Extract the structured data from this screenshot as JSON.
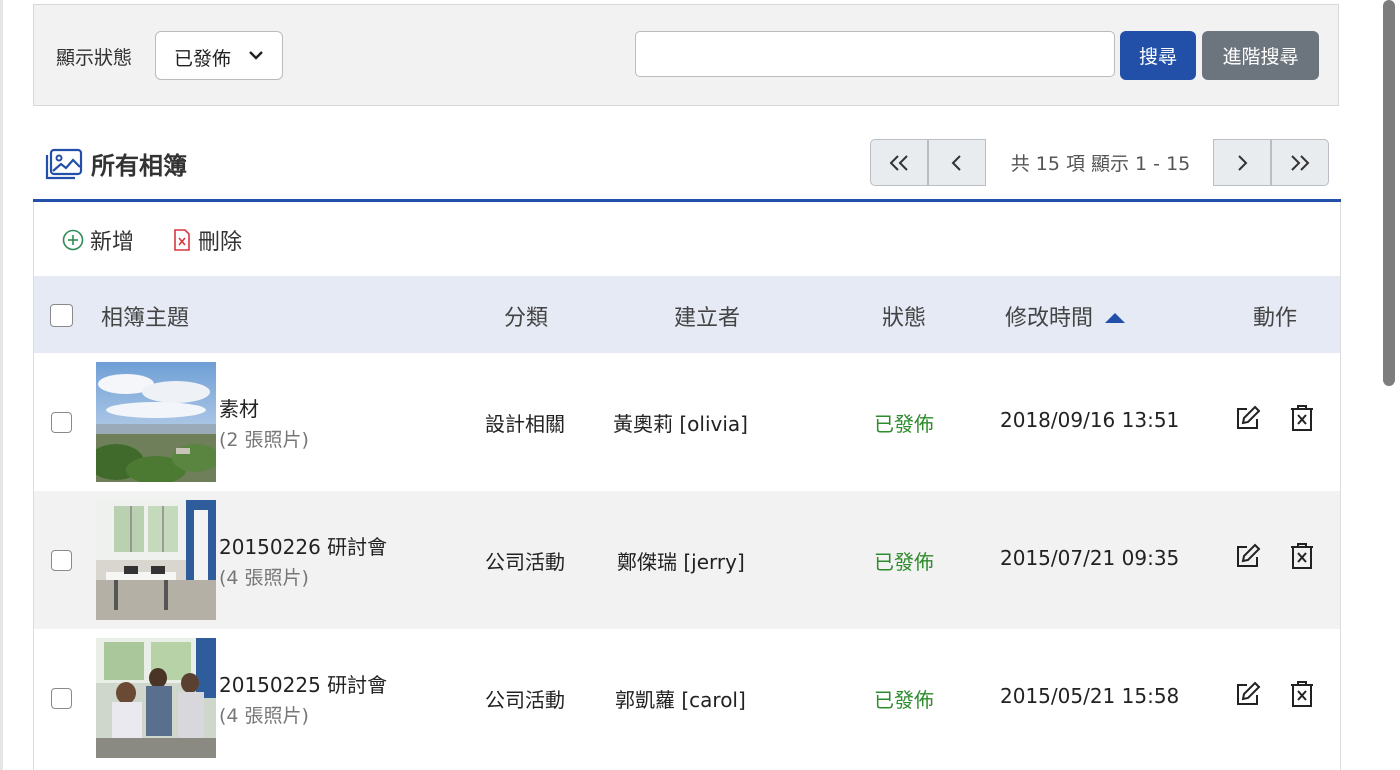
{
  "filter": {
    "status_label": "顯示狀態",
    "status_value": "已發佈",
    "search_value": "",
    "search_button": "搜尋",
    "advanced_button": "進階搜尋"
  },
  "section": {
    "title": "所有相簿"
  },
  "pager": {
    "info": "共 15 項 顯示 1 - 15"
  },
  "toolbar": {
    "add": "新增",
    "delete": "刪除"
  },
  "table": {
    "headers": {
      "subject": "相簿主題",
      "category": "分類",
      "creator": "建立者",
      "status": "狀態",
      "modified": "修改時間",
      "actions": "動作"
    },
    "sort_indicator": "ascending",
    "rows": [
      {
        "title": "素材",
        "count": "(2 張照片)",
        "category": "設計相關",
        "creator": "黃奧莉 [olivia]",
        "status": "已發佈",
        "modified": "2018/09/16 13:51"
      },
      {
        "title": "20150226 研討會",
        "count": "(4 張照片)",
        "category": "公司活動",
        "creator": "鄭傑瑞 [jerry]",
        "status": "已發佈",
        "modified": "2015/07/21 09:35"
      },
      {
        "title": "20150225 研討會",
        "count": "(4 張照片)",
        "category": "公司活動",
        "creator": "郭凱蘿 [carol]",
        "status": "已發佈",
        "modified": "2015/05/21 15:58"
      }
    ]
  },
  "colors": {
    "primary": "#2250a8",
    "secondary": "#6c757d",
    "status_published": "#2e8b2e",
    "header_bg": "#e5eaf5"
  }
}
